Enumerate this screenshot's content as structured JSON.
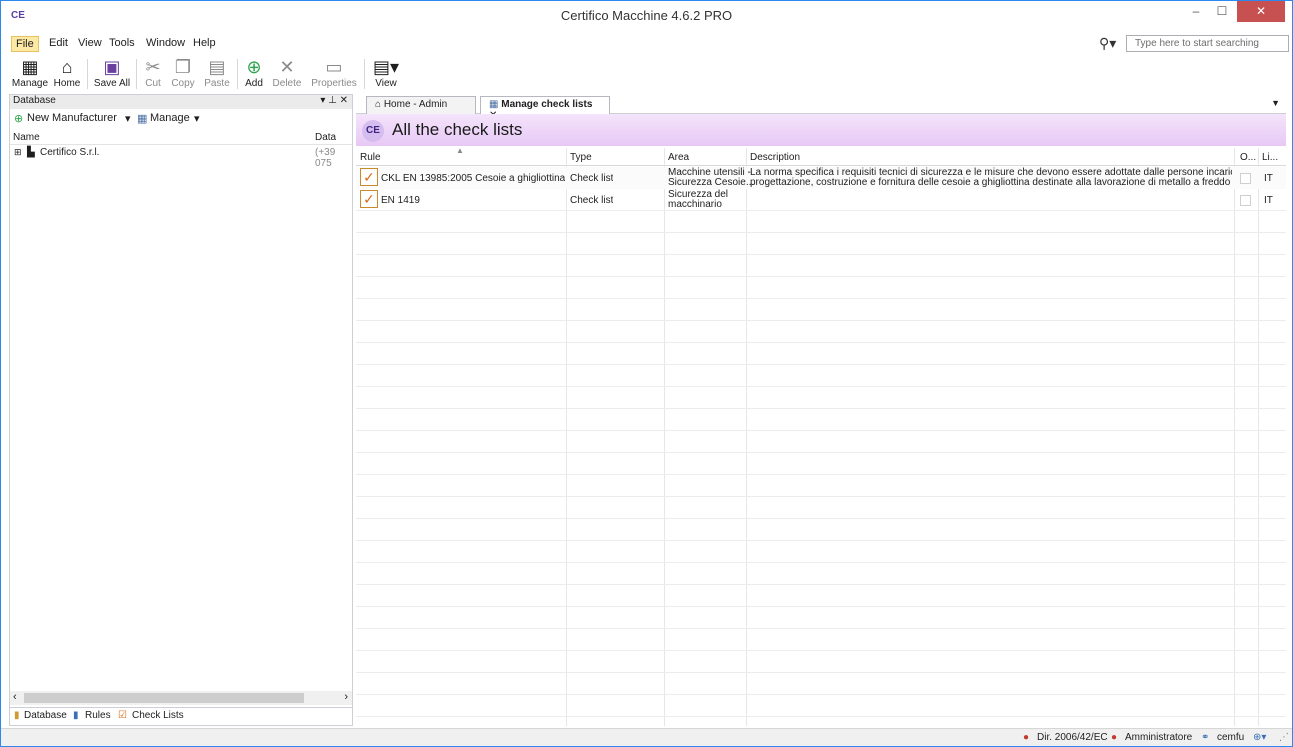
{
  "window": {
    "title": "Certifico Macchine 4.6.2 PRO",
    "app_icon": "CE"
  },
  "menu": [
    "File",
    "Edit",
    "View",
    "Tools",
    "Window",
    "Help"
  ],
  "search": {
    "placeholder": "Type here to start searching"
  },
  "toolbar": {
    "manage": "Manage",
    "home": "Home",
    "save_all": "Save All",
    "cut": "Cut",
    "copy": "Copy",
    "paste": "Paste",
    "add": "Add",
    "delete": "Delete",
    "properties": "Properties",
    "view": "View"
  },
  "left_panel": {
    "title": "Database",
    "new_manufacturer": "New Manufacturer",
    "manage": "Manage",
    "col_name": "Name",
    "col_data": "Data",
    "tree": [
      {
        "name": "Certifico S.r.l.",
        "data": "(+39 075"
      }
    ],
    "tabs": [
      "Database",
      "Rules",
      "Check Lists"
    ]
  },
  "doc": {
    "tabs": [
      "Home - Admin",
      "Manage check lists"
    ],
    "title": "All the check lists",
    "columns": [
      "Rule",
      "Type",
      "Area",
      "Description",
      "O...",
      "Li..."
    ],
    "rows": [
      {
        "rule": "CKL EN 13985:2005 Cesoie a ghigliottina",
        "type": "Check list",
        "area1": "Macchine utensili -",
        "area2": "Sicurezza Cesoie...",
        "desc1": "La norma specifica i requisiti tecnici di sicurezza e le misure che devono essere adottate dalle persone incaricate della",
        "desc2": "progettazione, costruzione e fornitura delle cesoie a ghigliottina destinate alla lavorazione di metallo a freddo o di...",
        "lang": "IT"
      },
      {
        "rule": "EN 1419",
        "type": "Check list",
        "area1": "Sicurezza del",
        "area2": "macchinario",
        "desc1": "",
        "desc2": "",
        "lang": "IT"
      }
    ]
  },
  "status": {
    "directive": "Dir. 2006/42/EC",
    "user": "Amministratore",
    "db": "cemfu"
  }
}
